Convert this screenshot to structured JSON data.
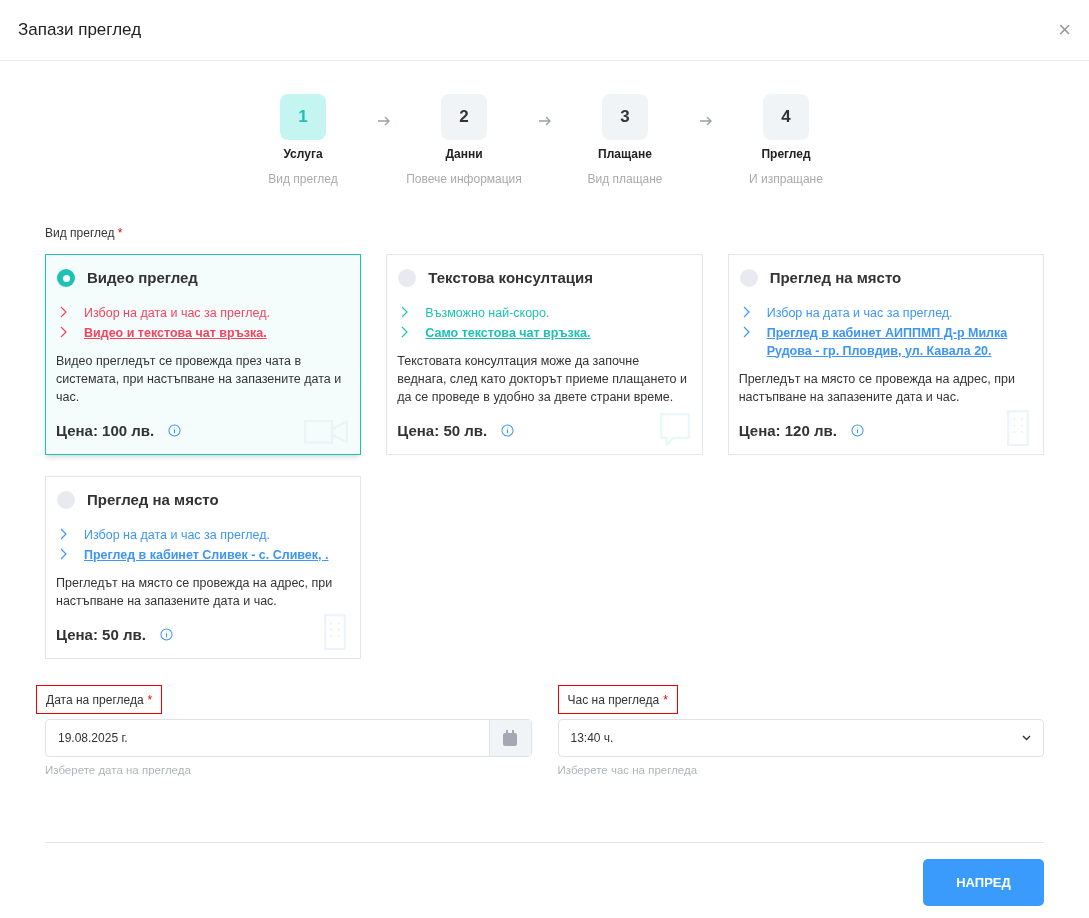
{
  "window": {
    "title": "Запази преглед",
    "close": "×"
  },
  "steps": [
    {
      "number": "1",
      "title": "Услуга",
      "subtitle": "Вид преглед",
      "selected": true
    },
    {
      "number": "2",
      "title": "Данни",
      "subtitle": "Повече информация",
      "selected": false
    },
    {
      "number": "3",
      "title": "Плащане",
      "subtitle": "Вид плащане",
      "selected": false
    },
    {
      "number": "4",
      "title": "Преглед",
      "subtitle": "И изпращане",
      "selected": false
    }
  ],
  "service_type": {
    "label": "Вид преглед",
    "required": "*"
  },
  "options": [
    {
      "title": "Видео преглед",
      "selected": true,
      "color": "#f5445e",
      "kind": "video",
      "features": [
        {
          "text": "Избор на дата и час за преглед.",
          "kind": "plain"
        },
        {
          "text": "Видео и текстова чат връзка.",
          "kind": "link"
        }
      ],
      "description": "Видео прегледът се провежда през чата в системата, при настъпване на запазените дата и час.",
      "price": "Цена: 100 лв."
    },
    {
      "title": "Текстова консултация",
      "selected": false,
      "color": "#1ec2b4",
      "kind": "chat",
      "features": [
        {
          "text": "Възможно най-скоро.",
          "kind": "plain"
        },
        {
          "text": "Само текстова чат връзка.",
          "kind": "link"
        }
      ],
      "description": "Текстовата консултация може да започне веднага, след като докторът приеме плащането и да се проведе в удобно за двете страни време.",
      "price": "Цена: 50 лв."
    },
    {
      "title": "Преглед на място",
      "selected": false,
      "color": "#3d95f5",
      "kind": "building",
      "features": [
        {
          "text": "Избор на дата и час за преглед.",
          "kind": "plain"
        },
        {
          "text": "Преглед в кабинет АИППМП Д-р Милка Рудова - гр. Пловдив, ул. Кавала 20.",
          "kind": "link"
        }
      ],
      "description": "Прегледът на място се провежда на адрес, при настъпване на запазените дата и час.",
      "price": "Цена: 120 лв."
    },
    {
      "title": "Преглед на място",
      "selected": false,
      "color": "#3d95f5",
      "kind": "building",
      "features": [
        {
          "text": "Избор на дата и час за преглед.",
          "kind": "plain"
        },
        {
          "text": "Преглед в кабинет Сливек - с. Сливек, .",
          "kind": "link"
        }
      ],
      "description": "Прегледът на място се провежда на адрес, при настъпване на запазените дата и час.",
      "price": "Цена: 50 лв."
    }
  ],
  "date_field": {
    "label": "Дата на прегледа",
    "required": "*",
    "highlighted": true,
    "value": "19.08.2025 г.",
    "hint": "Изберете дата на прегледа"
  },
  "time_field": {
    "label": "Час на прегледа",
    "required": "*",
    "highlighted": true,
    "value": "13:40 ч.",
    "hint": "Изберете час на прегледа"
  },
  "next_button": "НАПРЕД"
}
